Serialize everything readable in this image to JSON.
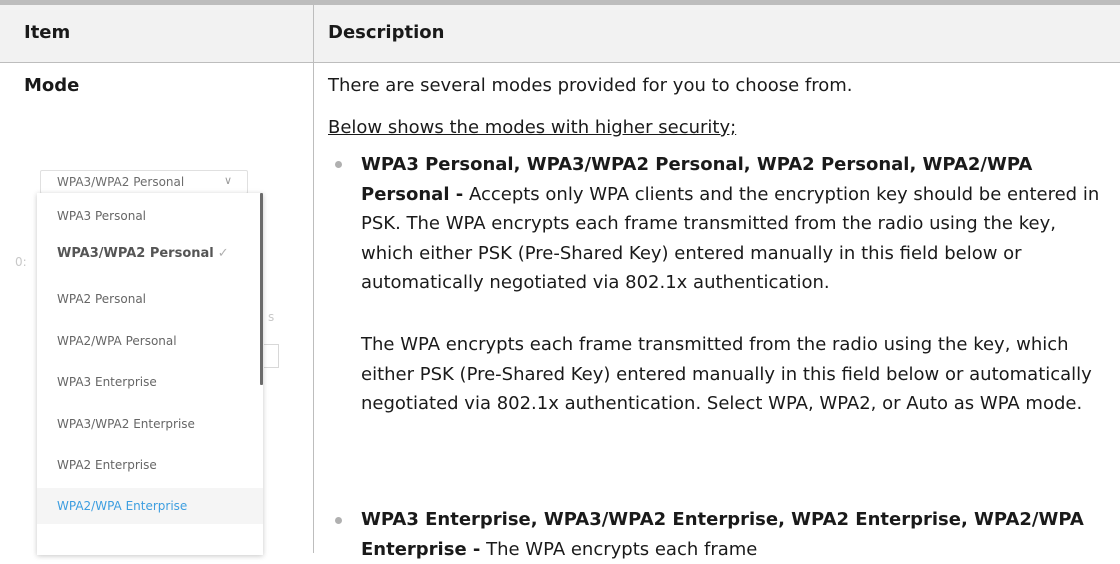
{
  "table": {
    "headers": {
      "item": "Item",
      "description": "Description"
    },
    "rows": [
      {
        "item": "Mode",
        "intro": "There are several modes provided for you to choose from.",
        "subheading": "Below shows the modes with higher security;",
        "bullets": [
          {
            "title": "WPA3 Personal, WPA3/WPA2 Personal, WPA2 Personal, WPA2/WPA Personal -",
            "text": " Accepts only WPA clients and the encryption key should be entered in PSK. The WPA encrypts each frame transmitted from the radio using the key, which either PSK (Pre-Shared Key) entered manually in this field below or automatically negotiated via 802.1x authentication.",
            "extra": "The WPA encrypts each frame transmitted from the radio using the key, which either PSK (Pre-Shared Key) entered manually in this field below or automatically negotiated via 802.1x authentication. Select WPA, WPA2, or Auto as WPA mode."
          },
          {
            "title": "WPA3 Enterprise, WPA3/WPA2 Enterprise, WPA2 Enterprise, WPA2/WPA Enterprise -",
            "text": " The WPA encrypts each frame"
          }
        ]
      }
    ]
  },
  "dropdown": {
    "selected_value": "WPA3/WPA2 Personal",
    "options": [
      "WPA3 Personal",
      "WPA3/WPA2 Personal",
      "WPA2 Personal",
      "WPA2/WPA Personal",
      "WPA3 Enterprise",
      "WPA3/WPA2 Enterprise",
      "WPA2 Enterprise",
      "WPA2/WPA Enterprise"
    ],
    "selected_index": 1,
    "hover_index": 7,
    "check_glyph": "✓",
    "chevron_icon": "chevron-down-icon",
    "background_fragments": [
      "0:",
      "s"
    ]
  },
  "colors": {
    "header_bg": "#f2f2f2",
    "rule": "#bdbdbd",
    "hover_text": "#3d9ee0"
  }
}
